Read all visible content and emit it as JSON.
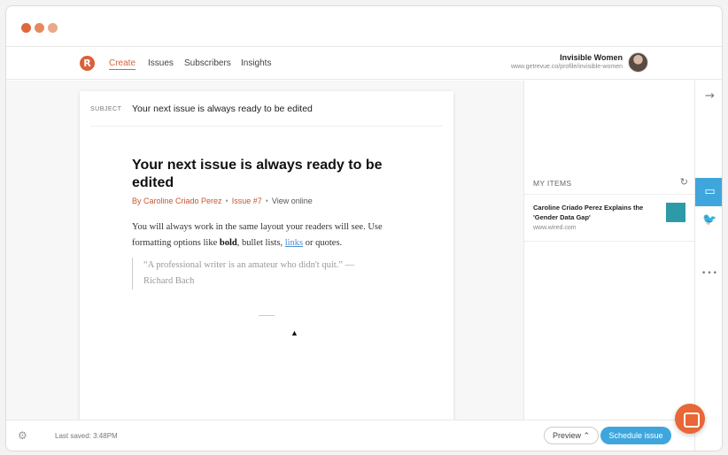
{
  "window": {
    "traffic_light_colors": [
      "#e1673b",
      "#e58a5c",
      "#e9a98a"
    ]
  },
  "nav": {
    "logo_icon": "revue-logo-icon",
    "links": [
      {
        "label": "Create",
        "active": true
      },
      {
        "label": "Issues",
        "active": false
      },
      {
        "label": "Subscribers",
        "active": false
      },
      {
        "label": "Insights",
        "active": false
      }
    ],
    "profile": {
      "name": "Invisible Women",
      "url": "www.getrevue.co/profile/invisible-women"
    }
  },
  "editor": {
    "subject_label": "SUBJECT",
    "subject_value": "Your next issue is always ready to be edited",
    "headline": "Your next issue is always ready to be edited",
    "byline": {
      "author": "By Caroline Criado Perez",
      "issue": "Issue #7",
      "view_online": "View online"
    },
    "body": {
      "part1": "You will always work in the same layout your readers will see. Use formatting options like ",
      "bold": "bold",
      "part2": ", bullet lists, ",
      "link": "links",
      "part3": " or quotes."
    },
    "quote": "“A professional writer is an amateur who didn't quit.” — Richard Bach"
  },
  "sidebar": {
    "items_title": "MY ITEMS",
    "refresh_icon": "refresh-icon",
    "items": [
      {
        "title": "Caroline Criado Perez Explains the 'Gender Data Gap'",
        "url": "www.wired.com"
      }
    ]
  },
  "rail": {
    "buttons": [
      {
        "icon": "arrow-right-icon",
        "glyph": "→"
      },
      {
        "icon": "inbox-icon",
        "glyph": "▭",
        "active": true
      },
      {
        "icon": "twitter-icon",
        "glyph": "🐦"
      },
      {
        "icon": "more-icon",
        "glyph": "•••"
      }
    ]
  },
  "footer": {
    "last_saved": "Last saved: 3:48PM",
    "preview_label": "Preview",
    "schedule_label": "Schedule issue"
  },
  "colors": {
    "brand": "#d9613a",
    "accent": "#3fa6dd",
    "chat": "#e96636"
  }
}
